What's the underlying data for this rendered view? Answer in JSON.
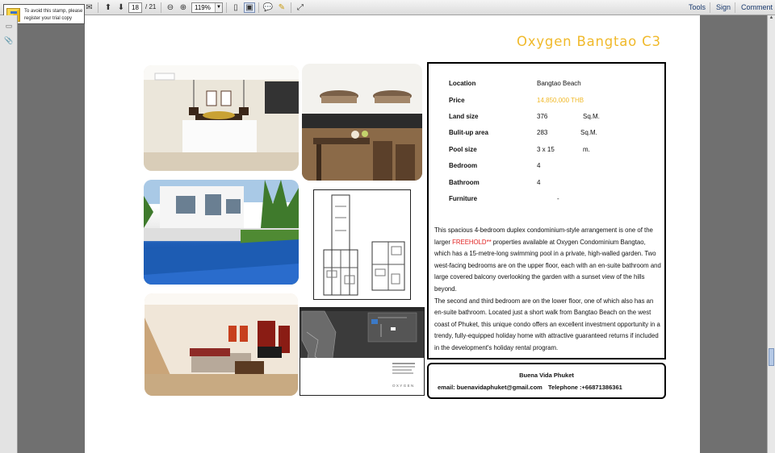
{
  "toolbar": {
    "current_page": "18",
    "total_pages": "/ 21",
    "zoom": "119%",
    "tools_label": "Tools",
    "sign_label": "Sign",
    "comment_label": "Comment"
  },
  "stamp": {
    "text": "To avoid this stamp, please register your trial copy"
  },
  "document": {
    "title": "Oxygen Bangtao C3",
    "specs": [
      {
        "label": "Location",
        "value": "Bangtao Beach",
        "unit": ""
      },
      {
        "label": "Price",
        "value": "14,850,000 THB",
        "unit": ""
      },
      {
        "label": "Land size",
        "value": "376",
        "unit": "Sq.M."
      },
      {
        "label": "Bulit-up area",
        "value": "283",
        "unit": "Sq.M."
      },
      {
        "label": "Pool size",
        "value": "3 x 15",
        "unit": "m."
      },
      {
        "label": "Bedroom",
        "value": "4",
        "unit": ""
      },
      {
        "label": "Bathroom",
        "value": "4",
        "unit": ""
      },
      {
        "label": "Furniture",
        "value": "-",
        "unit": ""
      }
    ],
    "desc_part1": "This spacious 4-bedroom duplex condominium-style arrangement is one of the larger ",
    "desc_highlight": "FREEHOLD**",
    "desc_part2": " properties available at Oxygen Condominium Bangtao, which has a 15-metre-long swimming pool in a private, high-walled garden. Two west-facing bedrooms are on the upper floor, each with an en-suite bathroom and large covered balcony overlooking the garden with a sunset view of the hills beyond.",
    "desc_part3": "The second and third bedroom are on the lower floor, one of which also has an en-suite bathroom. Located just a short walk from Bangtao Beach on the west coast of Phuket, this unique condo offers an excellent investment opportunity in a trendy, fully-equipped holiday home with attractive guaranteed returns if included in the development's holiday rental program.",
    "contact": {
      "name": "Buena Vida Phuket",
      "email": "email: buenavidaphuket@gmail.com",
      "telephone": "Telephone :+66871386361"
    },
    "map_brand": "OXYGEN"
  },
  "colors": {
    "title": "#f0b92a",
    "price": "#f0b92a",
    "highlight": "#e02020",
    "pool": "#1f5fb8"
  }
}
